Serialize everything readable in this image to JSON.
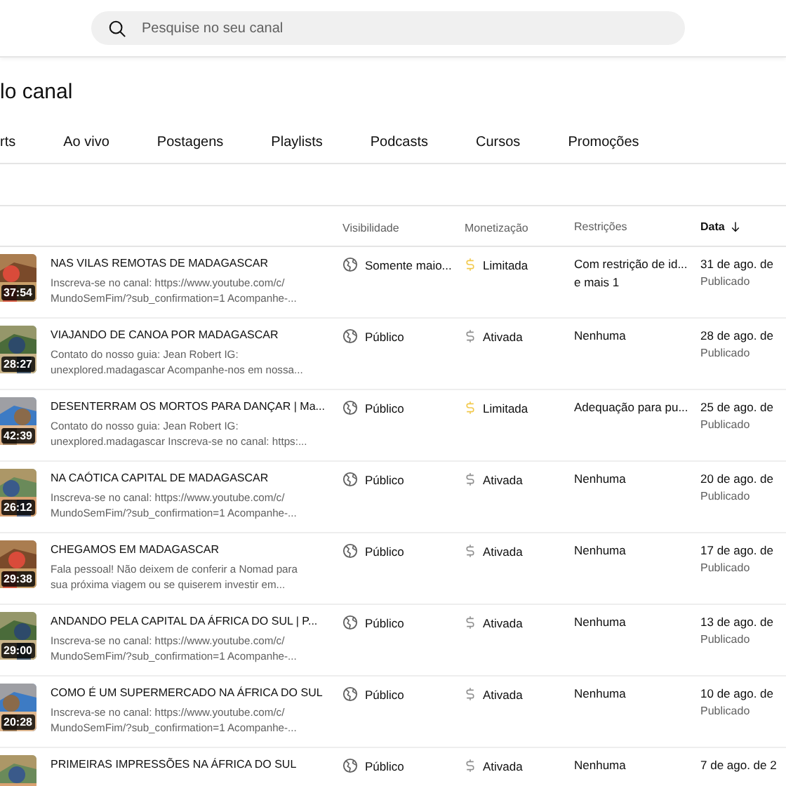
{
  "search": {
    "placeholder": "Pesquise no seu canal"
  },
  "page_title": "lo canal",
  "tabs": [
    {
      "label": "rts",
      "selected": false
    },
    {
      "label": "Ao vivo",
      "selected": false
    },
    {
      "label": "Postagens",
      "selected": false
    },
    {
      "label": "Playlists",
      "selected": false
    },
    {
      "label": "Podcasts",
      "selected": false
    },
    {
      "label": "Cursos",
      "selected": false
    },
    {
      "label": "Promoções",
      "selected": false
    }
  ],
  "table": {
    "columns": [
      "Visibilidade",
      "Monetização",
      "Restrições",
      "Data"
    ],
    "rows": [
      {
        "duration": "37:54",
        "title": "NAS VILAS REMOTAS DE MADAGASCAR",
        "description": "Inscreva-se no canal: https://www.youtube.com/c/ MundoSemFim/?sub_confirmation=1 Acompanhe-...",
        "visibility": "Somente maio...",
        "monetization": {
          "kind": "limited",
          "label": "Limitada"
        },
        "restrictions": [
          "Com restrição de id...",
          "e mais 1"
        ],
        "date": "31 de ago. de",
        "status": "Publicado"
      },
      {
        "duration": "28:27",
        "title": "VIAJANDO DE CANOA POR MADAGASCAR",
        "description": "Contato do nosso guia: Jean Robert IG: unexplored.madagascar Acompanhe-nos em nossa...",
        "visibility": "Público",
        "monetization": {
          "kind": "active",
          "label": "Ativada"
        },
        "restrictions": [
          "Nenhuma"
        ],
        "date": "28 de ago. de",
        "status": "Publicado"
      },
      {
        "duration": "42:39",
        "title": "DESENTERRAM OS MORTOS PARA DANÇAR | Ma...",
        "description": "Contato do nosso guia: Jean Robert IG: unexplored.madagascar Inscreva-se no canal: https:...",
        "visibility": "Público",
        "monetization": {
          "kind": "limited",
          "label": "Limitada"
        },
        "restrictions": [
          "Adequação para pu..."
        ],
        "date": "25 de ago. de",
        "status": "Publicado"
      },
      {
        "duration": "26:12",
        "title": "NA CAÓTICA CAPITAL DE MADAGASCAR",
        "description": "Inscreva-se no canal: https://www.youtube.com/c/ MundoSemFim/?sub_confirmation=1 Acompanhe-...",
        "visibility": "Público",
        "monetization": {
          "kind": "active",
          "label": "Ativada"
        },
        "restrictions": [
          "Nenhuma"
        ],
        "date": "20 de ago. de",
        "status": "Publicado"
      },
      {
        "duration": "29:38",
        "title": "CHEGAMOS EM MADAGASCAR",
        "description": "Fala pessoal! Não deixem de conferir a Nomad para sua próxima viagem ou se quiserem investir em...",
        "visibility": "Público",
        "monetization": {
          "kind": "active",
          "label": "Ativada"
        },
        "restrictions": [
          "Nenhuma"
        ],
        "date": "17 de ago. de",
        "status": "Publicado"
      },
      {
        "duration": "29:00",
        "title": "ANDANDO PELA CAPITAL DA ÁFRICA DO SUL | P...",
        "description": "Inscreva-se no canal: https://www.youtube.com/c/ MundoSemFim/?sub_confirmation=1 Acompanhe-...",
        "visibility": "Público",
        "monetization": {
          "kind": "active",
          "label": "Ativada"
        },
        "restrictions": [
          "Nenhuma"
        ],
        "date": "13 de ago. de",
        "status": "Publicado"
      },
      {
        "duration": "20:28",
        "title": "COMO É UM SUPERMERCADO NA ÁFRICA DO SUL",
        "description": "Inscreva-se no canal: https://www.youtube.com/c/ MundoSemFim/?sub_confirmation=1 Acompanhe-...",
        "visibility": "Público",
        "monetization": {
          "kind": "active",
          "label": "Ativada"
        },
        "restrictions": [
          "Nenhuma"
        ],
        "date": "10 de ago. de",
        "status": "Publicado"
      },
      {
        "title": "PRIMEIRAS IMPRESSÕES NA ÁFRICA DO SUL",
        "visibility": "Público",
        "monetization": {
          "kind": "active",
          "label": "Ativada"
        },
        "restrictions": [
          "Nenhuma"
        ],
        "date": "7 de ago. de 2"
      }
    ]
  }
}
